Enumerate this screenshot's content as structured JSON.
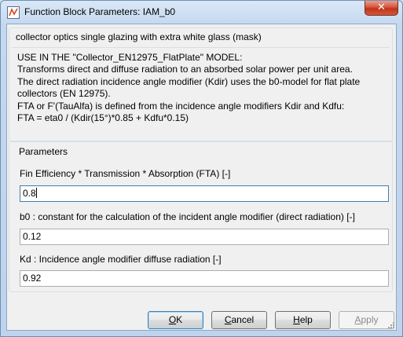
{
  "window": {
    "title": "Function Block Parameters: IAM_b0",
    "close_glyph": "✕"
  },
  "description": {
    "heading": "collector optics single glazing with extra white glass (mask)",
    "text": "USE IN THE \"Collector_EN12975_FlatPlate\" MODEL:\nTransforms direct and diffuse radiation to an absorbed solar power per unit area.\nThe direct radiation incidence angle modifier (Kdir) uses the b0-model for flat plate collectors (EN 12975).\nFTA or F'(TauAlfa) is defined from the incidence angle modifiers Kdir and Kdfu:\nFTA = eta0 / (Kdir(15°)*0.85 + Kdfu*0.15)"
  },
  "parameters": {
    "heading": "Parameters",
    "fields": [
      {
        "label": "Fin Efficiency * Transmission * Absorption (FTA) [-]",
        "value": "0.8"
      },
      {
        "label": "b0 : constant for the calculation of the incident angle modifier (direct radiation) [-]",
        "value": "0.12"
      },
      {
        "label": "Kd : Incidence angle modifier diffuse radiation [-]",
        "value": "0.92"
      }
    ]
  },
  "buttons": {
    "ok": {
      "mnemonic": "O",
      "rest": "K"
    },
    "cancel": {
      "mnemonic": "C",
      "rest": "ancel"
    },
    "help": {
      "mnemonic": "H",
      "rest": "elp"
    },
    "apply": {
      "mnemonic": "A",
      "rest": "pply",
      "enabled": false
    }
  },
  "icons": {
    "app": "simulink-block-icon",
    "close": "close-icon",
    "resize": "resize-grip-icon"
  }
}
